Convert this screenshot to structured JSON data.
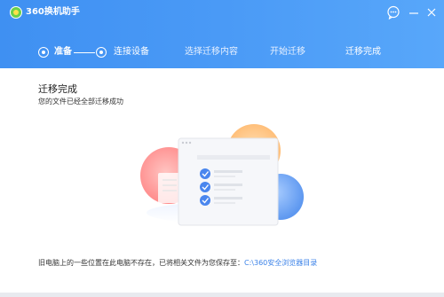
{
  "app": {
    "title": "360换机助手"
  },
  "window_controls": {
    "feedback": "feedback-icon",
    "minimize": "minimize-icon",
    "close": "close-icon"
  },
  "steps": [
    {
      "label": "准备",
      "state": "done"
    },
    {
      "label": "连接设备",
      "state": "done"
    },
    {
      "label": "选择迁移内容",
      "state": "pending"
    },
    {
      "label": "开始迁移",
      "state": "pending"
    },
    {
      "label": "迁移完成",
      "state": "current"
    }
  ],
  "result": {
    "title": "迁移完成",
    "subtitle": "您的文件已经全部迁移成功"
  },
  "illustration": {
    "checklist_items": 3
  },
  "notice": {
    "text": "旧电脑上的一些位置在此电脑不存在，已将相关文件为您保存至：",
    "folder_path": "C:\\360安全浏览器目录"
  },
  "colors": {
    "header_start": "#3f90f2",
    "header_end": "#58a7fa",
    "accent": "#3b82e8",
    "check": "#4a86ee"
  }
}
